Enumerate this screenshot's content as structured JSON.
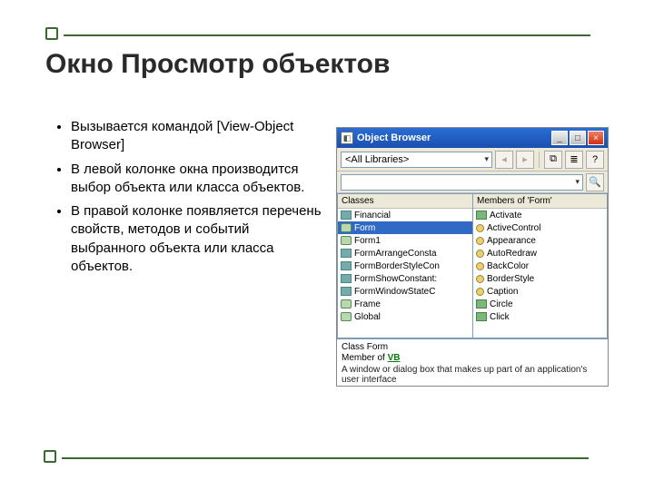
{
  "slide": {
    "title": "Окно Просмотр объектов",
    "bullets": [
      "Вызывается командой [View-Object Browser]",
      "В левой колонке окна производится выбор объекта или класса объектов.",
      "В правой колонке появляется перечень свойств, методов и событий выбранного объекта или класса объектов."
    ]
  },
  "window": {
    "title": "Object Browser",
    "library_dropdown": "<All Libraries>",
    "search_value": "",
    "nav_back": "◂",
    "nav_fwd": "▸",
    "btn_copy": "⧉",
    "btn_view": "≣",
    "btn_help": "?",
    "btn_search": "🔍",
    "left_header": "Classes",
    "right_header": "Members of 'Form'",
    "classes": [
      "Financial",
      "Form",
      "Form1",
      "FormArrangeConsta",
      "FormBorderStyleCon",
      "FormShowConstant:",
      "FormWindowStateC",
      "Frame",
      "Global"
    ],
    "members": [
      "Activate",
      "ActiveControl",
      "Appearance",
      "AutoRedraw",
      "BackColor",
      "BorderStyle",
      "Caption",
      "Circle",
      "Click"
    ],
    "details": {
      "class_label": "Class Form",
      "member_prefix": "Member of ",
      "member_lib": "VB",
      "description": "A window or dialog box that makes up part of an application's user interface"
    }
  }
}
